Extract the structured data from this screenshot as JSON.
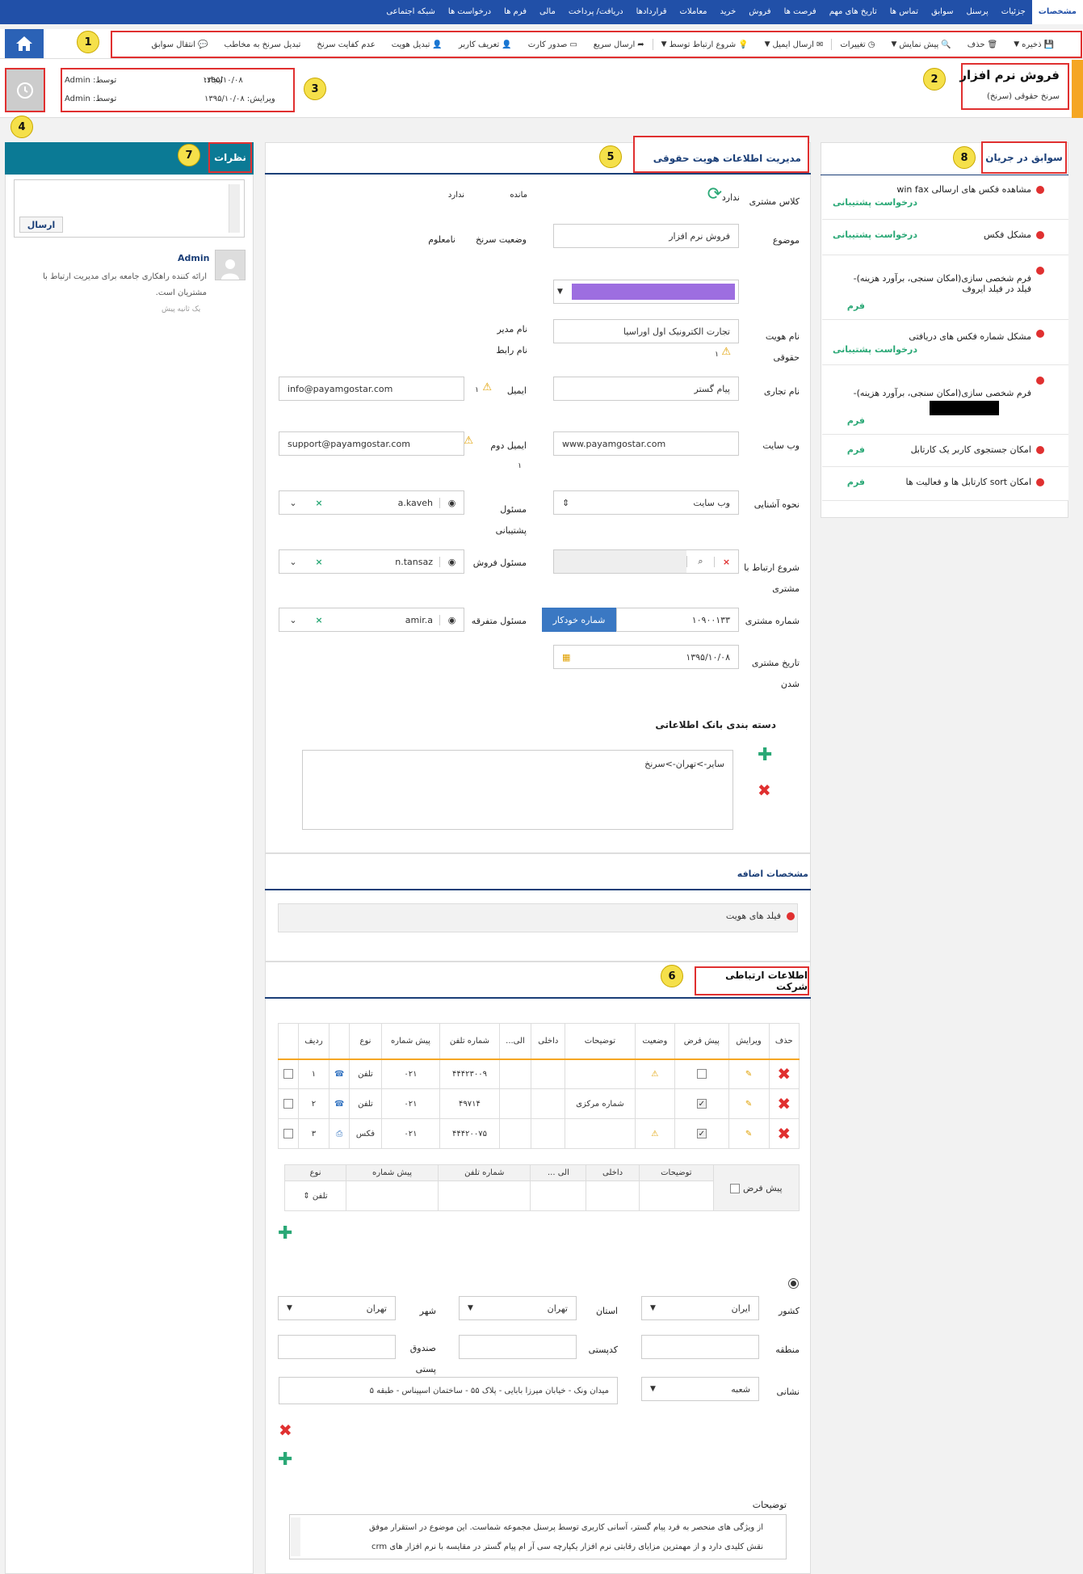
{
  "nav": {
    "items": [
      "مشخصات",
      "جزئیات",
      "پرسنل",
      "سوابق",
      "تماس ها",
      "تاریخ های مهم",
      "فرصت ها",
      "فروش",
      "خرید",
      "معاملات",
      "قراردادها",
      "دریافت/ پرداخت",
      "مالی",
      "فرم ها",
      "درخواست ها",
      "شبکه اجتماعی"
    ]
  },
  "toolbar": {
    "save": "ذخیره",
    "delete": "حذف",
    "preview": "پیش نمایش",
    "changes": "تغییرات",
    "send_email": "ارسال ایمیل",
    "start_contact": "شروع ارتباط توسط",
    "send_fast": "ارسال سریع",
    "issue_card": "صدور کارت",
    "define_user": "تعریف کاربر",
    "change_identity": "تبدیل هویت",
    "lead_disqual": "عدم کفایت سرنخ",
    "lead_to_contact": "تبدیل سرنخ به مخاطب",
    "transfer_history": "انتقال سوابق"
  },
  "header": {
    "title": "فروش نرم افزار",
    "subtitle": "سرنخ حقوقی (سرنخ)",
    "created_label": "ایجاد:",
    "created_date": "۱۳۹۵/۱۰/۰۸",
    "created_by_label": "توسط:",
    "created_by": "Admin",
    "edited_label": "ویرایش:",
    "edited_date": "۱۳۹۵/۱۰/۰۸",
    "edited_by_label": "توسط:",
    "edited_by": "Admin"
  },
  "callouts": [
    "1",
    "2",
    "3",
    "4",
    "5",
    "6",
    "7",
    "8"
  ],
  "history": {
    "title": "سوابق در جریان",
    "items": [
      {
        "text": "مشاهده فکس های ارسالی win fax",
        "status": "درخواست پشتیبانی"
      },
      {
        "text": "مشکل فکس",
        "status": "درخواست پشتیبانی"
      },
      {
        "text": "فرم شخصی سازی(امکان سنجی، برآورد هزینه)-فیلد در فیلد ایروف",
        "status": "فرم"
      },
      {
        "text": "مشکل شماره فکس های دریافتی",
        "status": "درخواست پشتیبانی"
      },
      {
        "text": "فرم شخصی سازی(امکان سنجی، برآورد هزینه)-",
        "status": "فرم"
      },
      {
        "text": "امکان جستجوی کاربر یک کارتابل",
        "status": "فرم"
      },
      {
        "text": "امکان sort کارتابل ها و فعالیت ها",
        "status": "فرم"
      }
    ]
  },
  "identity": {
    "title": "مدیریت اطلاعات هویت حقوقی",
    "customer_class_label": "کلاس مشتری",
    "customer_class_value": "ندارد",
    "remaining_label": "مانده",
    "remaining_value": "ندارد",
    "subject_label": "موضوع",
    "subject_value": "فروش نرم افزار",
    "lead_status_label": "وضعیت سرنخ",
    "lead_status_value": "نامعلوم",
    "color_value": "#9d6ee0",
    "legal_name_label": "نام هویت حقوقی",
    "legal_name_value": "تجارت الکترونیک اول اوراسیا",
    "manager_label": "نام مدیر",
    "contact_name_label": "نام رابط",
    "trade_name_label": "نام تجاری",
    "trade_name_value": "پیام گستر",
    "email_label": "ایمیل",
    "email_value": "info@payamgostar.com",
    "email_count": "۱",
    "website_label": "وب سایت",
    "website_value": "www.payamgostar.com",
    "email2_label": "ایمیل دوم",
    "email2_value": "support@payamgostar.com",
    "email2_count": "۱",
    "legal_warn_count": "۱",
    "acquaint_label": "نحوه آشنایی",
    "acquaint_value": "وب سایت",
    "support_owner_label": "مسئول پشتیبانی",
    "support_owner_value": "a.kaveh",
    "start_contact_label": "شروع ارتباط با مشتری",
    "sales_owner_label": "مسئول فروش",
    "sales_owner_value": "n.tansaz",
    "customer_number_label": "شماره مشتری",
    "customer_number_value": "۱۰۹۰۰۱۳۳",
    "auto_number": "شماره خودکار",
    "misc_owner_label": "مسئول متفرقه",
    "misc_owner_value": "amir.a",
    "customer_date_label": "تاریخ مشتری شدن",
    "customer_date_value": "۱۳۹۵/۱۰/۰۸",
    "category_title": "دسته بندی بانک اطلاعاتی",
    "category_value": "سایر->تهران->سرنخ"
  },
  "extra": {
    "title": "مشخصات اضافه",
    "identity_fields": "فیلد های هویت"
  },
  "company": {
    "title": "اطلاعات ارتباطی شرکت",
    "headers": [
      "ردیف",
      "نوع",
      "پیش شماره",
      "شماره تلفن",
      "الی...",
      "داخلی",
      "توضیحات",
      "وضعیت",
      "پیش فرض",
      "ویرایش",
      "حذف"
    ],
    "rows": [
      {
        "n": "۱",
        "type": "تلفن",
        "pre": "۰۲۱",
        "phone": "۴۴۴۲۳۰۰۹",
        "desc": ""
      },
      {
        "n": "۲",
        "type": "تلفن",
        "pre": "۰۲۱",
        "phone": "۴۹۷۱۴",
        "desc": "شماره مرکزی"
      },
      {
        "n": "۳",
        "type": "فکس",
        "pre": "۰۲۱",
        "phone": "۴۴۴۲۰۰۷۵",
        "desc": ""
      }
    ],
    "new_headers": {
      "type": "نوع",
      "pre": "پیش شماره",
      "phone": "شماره تلفن",
      "to": "الی ...",
      "ext": "داخلی",
      "desc": "توضیحات",
      "default": "پیش فرض"
    },
    "new_type": "تلفن",
    "country_label": "کشور",
    "country_value": "ایران",
    "province_label": "استان",
    "province_value": "تهران",
    "city_label": "شهر",
    "city_value": "تهران",
    "region_label": "منطقه",
    "postcode_label": "کدپستی",
    "pobox_label": "صندوق پستی",
    "address_label": "نشانی",
    "address_type": "شعبه",
    "address_value": "میدان ونک - خیابان میرزا بابایی - پلاک ۵۵ - ساختمان اسپیناس - طبقه ۵",
    "notes_label": "توضیحات",
    "notes_line1": "از ویژگی های منحصر به فرد پیام گستر، آسانی کاربری توسط پرسنل مجموعه شماست. این موضوع در استقرار موفق",
    "notes_line2": "نقش کلیدی دارد و از مهمترین مزایای رقابتی نرم افزار یکپارچه سی آر ام پیام گستر در مقایسه با نرم افزار های crm"
  },
  "comments": {
    "title": "نظرات",
    "send": "ارسال",
    "author": "Admin",
    "text": "ارائه کننده راهکاری جامعه برای مدیریت ارتباط با مشتریان است.",
    "time": "یک ثانیه پیش"
  },
  "colors": {
    "nav": "#2150a8",
    "accent": "#2b62b6",
    "green": "#2aa876",
    "red": "#e03030",
    "teal": "#0b7a95"
  }
}
